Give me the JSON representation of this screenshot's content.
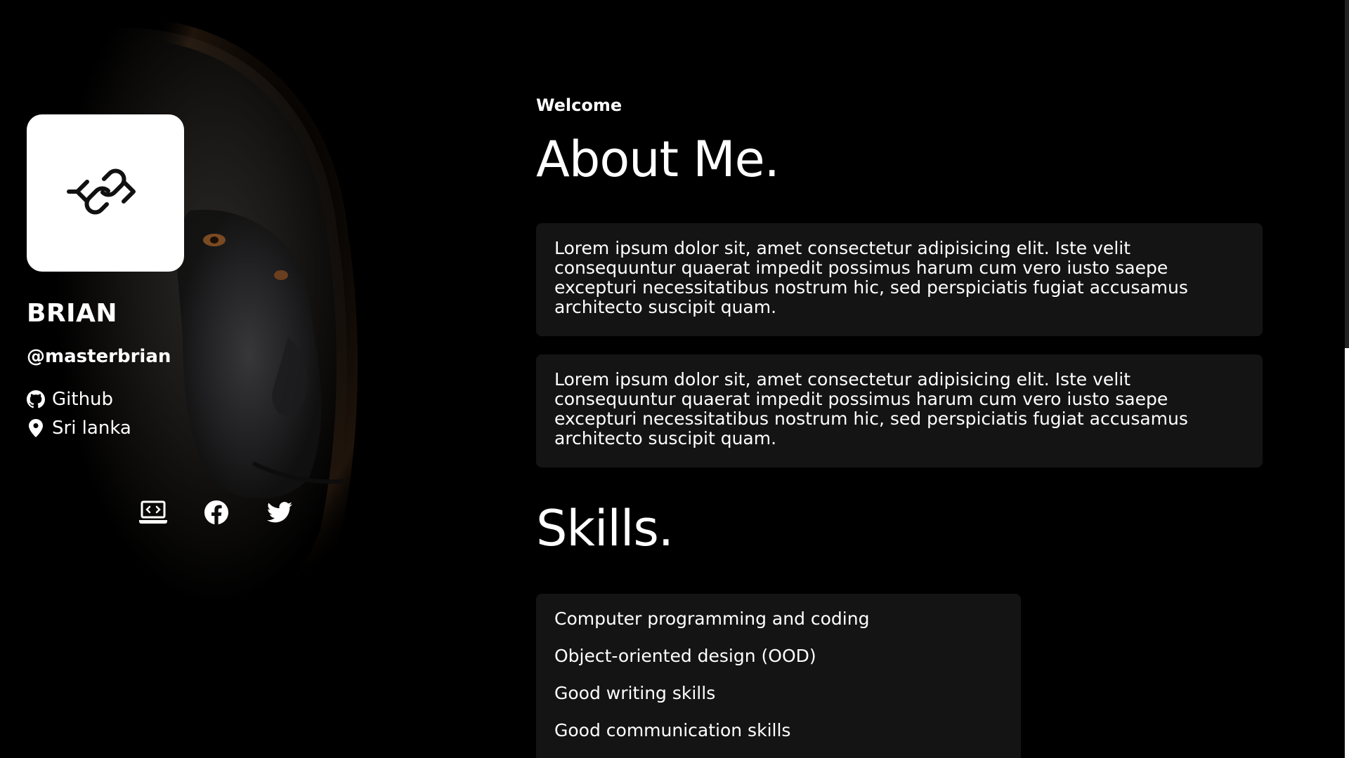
{
  "sidebar": {
    "name": "BRIAN",
    "handle": "@masterbrian",
    "github_label": "Github",
    "location_label": "Sri lanka",
    "logo_icon": "code-link-icon",
    "social_icons": [
      "laptop-code-icon",
      "facebook-icon",
      "twitter-icon"
    ]
  },
  "main": {
    "eyebrow": "Welcome",
    "about_title": "About Me.",
    "about_paragraphs": [
      "Lorem ipsum dolor sit, amet consectetur adipisicing elit. Iste velit consequuntur quaerat impedit possimus harum cum vero iusto saepe excepturi necessitatibus nostrum hic, sed perspiciatis fugiat accusamus architecto suscipit quam.",
      "Lorem ipsum dolor sit, amet consectetur adipisicing elit. Iste velit consequuntur quaerat impedit possimus harum cum vero iusto saepe excepturi necessitatibus nostrum hic, sed perspiciatis fugiat accusamus architecto suscipit quam."
    ],
    "skills_title": "Skills.",
    "skills": [
      "Computer programming and coding",
      "Object-oriented design (OOD)",
      "Good writing skills",
      "Good communication skills"
    ]
  },
  "colors": {
    "background": "#000000",
    "card": "#141414",
    "text": "#ffffff",
    "logo_card": "#ffffff"
  }
}
